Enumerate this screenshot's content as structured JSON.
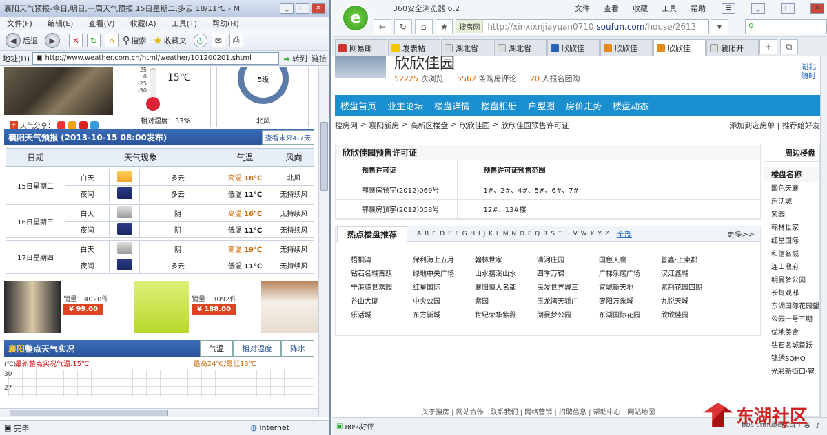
{
  "ie": {
    "title": "襄阳天气预报-今日,明日,一周天气预报,15日星期二,多云 18/11℃ - Mi",
    "menu": [
      "文件(F)",
      "编辑(E)",
      "查看(V)",
      "收藏(A)",
      "工具(T)",
      "帮助(H)"
    ],
    "toolbar": {
      "back": "后退",
      "search": "搜索",
      "favorites": "收藏夹"
    },
    "address_label": "地址(D)",
    "address": "http://www.weather.com.cn/html/weather/101200201.shtml",
    "go": "转到",
    "links": "链接",
    "status": "完毕",
    "zone": "Internet"
  },
  "weather": {
    "scale": [
      "25",
      "0",
      "-25",
      "-50"
    ],
    "temp": "15℃",
    "humidity": "相对湿度：53%",
    "wind_level": "5级",
    "wind_dir": "北风",
    "share": "天气分享：",
    "forecast_title": "襄阳天气预报 (2013-10-15  08:00发布)",
    "forecast_more": "查看未来4-7天",
    "columns": [
      "日期",
      "天气现象",
      "气温",
      "风向"
    ],
    "days": [
      {
        "date": "15日星期二",
        "day": {
          "period": "白天",
          "icon": "sun-cloud-icon",
          "desc": "多云",
          "tlabel": "高温",
          "temp": "18℃",
          "wind": "北风"
        },
        "night": {
          "period": "夜间",
          "icon": "moon-cloud-icon",
          "desc": "多云",
          "tlabel": "低温",
          "temp": "11℃",
          "wind": "无持续风"
        }
      },
      {
        "date": "16日星期三",
        "day": {
          "period": "白天",
          "icon": "cloud-icon",
          "desc": "阴",
          "tlabel": "高温",
          "temp": "16℃",
          "wind": "无持续风"
        },
        "night": {
          "period": "夜间",
          "icon": "moon-cloud-icon",
          "desc": "阴",
          "tlabel": "低温",
          "temp": "11℃",
          "wind": "无持续风"
        }
      },
      {
        "date": "17日星期四",
        "day": {
          "period": "白天",
          "icon": "cloud-icon",
          "desc": "阴",
          "tlabel": "高温",
          "temp": "19℃",
          "wind": "无持续风"
        },
        "night": {
          "period": "夜间",
          "icon": "moon-cloud-icon",
          "desc": "多云",
          "tlabel": "低温",
          "temp": "11℃",
          "wind": "无持续风"
        }
      }
    ],
    "goods": [
      {
        "sales": "销量：4020件",
        "price": "¥ 99.00"
      },
      {
        "sales": "销量：3092件",
        "price": "¥ 188.00"
      }
    ],
    "obs_city": "襄阳",
    "obs_title": "整点天气实况",
    "obs_tabs": [
      "气温",
      "相对湿度",
      "降水"
    ],
    "obs_latest": "最新整点实况气温:15℃",
    "obs_range": "最高24℃/最低13℃",
    "obs_unit": "(℃)",
    "obs_axis": [
      "30",
      "27"
    ]
  },
  "b360": {
    "title": "360安全浏览器 6.2",
    "menu": [
      "文件",
      "查看",
      "收藏",
      "工具",
      "帮助"
    ],
    "engine": "搜房网",
    "url_pre": "http://xinxixnjiayuan0710.",
    "url_dom": "soufun.com",
    "url_post": "/house/2613",
    "tabs": [
      "网易邮",
      "发表帖",
      "湖北省",
      "湖北省",
      "欣欣佳",
      "欣欣佳",
      "欣欣佳",
      "襄阳开"
    ],
    "status": "80%好评"
  },
  "property": {
    "name": "欣欣佳园",
    "views_n": "52225",
    "views": "次浏览",
    "reviews_n": "5562",
    "reviews": "条购房评论",
    "signup_n": "20",
    "signup": "人报名团购",
    "side_top": "湖北",
    "side_top2": "随时",
    "nav": [
      "楼盘首页",
      "业主论坛",
      "楼盘详情",
      "楼盘相册",
      "户型图",
      "房价走势",
      "楼盘动态"
    ],
    "crumbs": [
      "搜房网",
      "襄阳新房",
      "高新区楼盘",
      "欣欣佳园",
      "欣欣佳园预售许可证"
    ],
    "crumb_right": "添加到选房单  |  推荐给好友",
    "permit_title": "欣欣佳园预售许可证",
    "permit_cols": [
      "预售许可证",
      "预售许可证预售范围"
    ],
    "permits": [
      {
        "no": "鄂襄房预字(2012)069号",
        "range": "1#、2#、4#、5#、6#、7#"
      },
      {
        "no": "鄂襄房预字(2012)058号",
        "range": "12#、13#楼"
      }
    ],
    "hot_title": "热点楼盘推荐",
    "letters": "A B C D E F G H I J K L M N O P Q R S T U V W X Y Z",
    "all": "全部",
    "more": "更多>>",
    "hot": [
      "梧桐湾",
      "保利海上五月",
      "翰林世家",
      "清河庄园",
      "国色天襄",
      "普鑫·上東郡",
      "钻石名城首跃",
      "绿地中央广场",
      "山水禧溪山水",
      "四季万锦",
      "广梯乐居广场",
      "汉江鑫城",
      "宁港盛世嘉园",
      "红星国际",
      "襄阳恒大名都",
      "民发世界城三",
      "宜城新天地",
      "紫荆花园四期",
      "谷山大厦",
      "中央公园",
      "紫园",
      "玉龙湾天骄广",
      "枣阳万象城",
      "九悦天城",
      "乐活城",
      "东方新城",
      "世纪荣华紫薇",
      "朗曼梦公园",
      "东湖国际花园",
      "欣欣佳园"
    ],
    "side_title": "周边楼盘",
    "side_head": "楼盘名称",
    "side_items": [
      "国色天襄",
      "乐活城",
      "紫园",
      "翰林世家",
      "红星国际",
      "和信名城",
      "连山鼎府",
      "明曼梦公园",
      "长虹观邸",
      "东湖国际花园望",
      "公园一号三期",
      "优地美舍",
      "钻石名城首跃",
      "锦绣SOHO",
      "光彩新街口·智"
    ],
    "footer": "关于搜房   |   网站合作   |   联系我们   |   网络营销   |   招聘信息   |   帮助中心   |   网站地图"
  },
  "watermark": {
    "text": "东湖社区",
    "sub": "bbs.cnhubei.com"
  },
  "colors": {
    "nav_blue": "#1a8fd0",
    "wx_blue": "#2b559a",
    "hot_orange": "#e60"
  }
}
